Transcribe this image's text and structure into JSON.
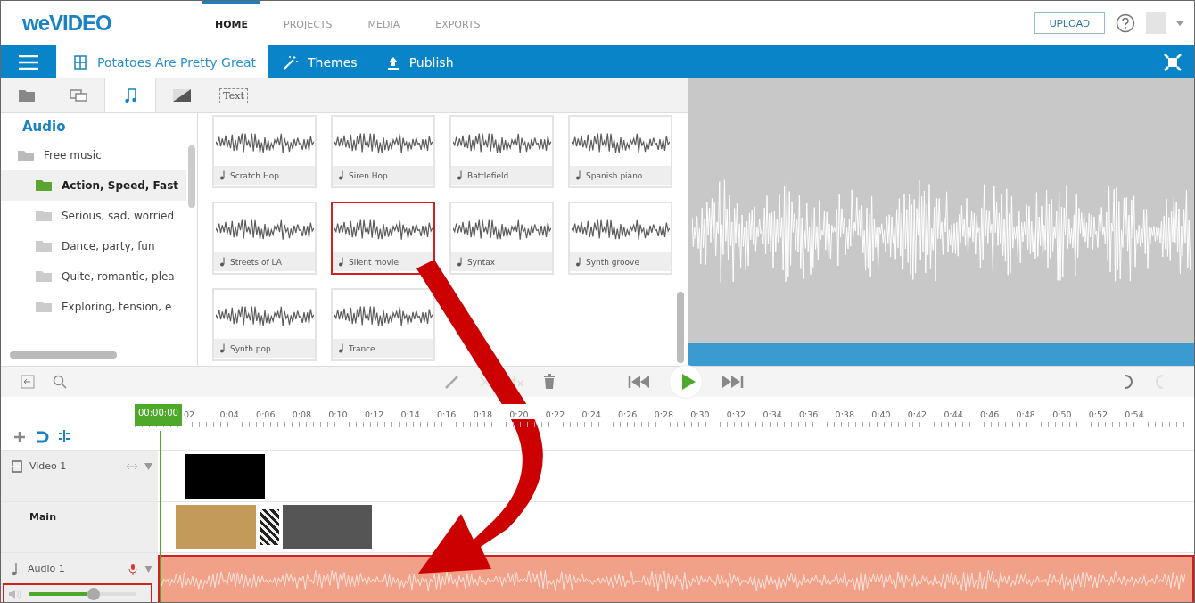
{
  "header": {
    "logo": "weVIDEO",
    "nav": [
      {
        "label": "HOME",
        "selected": true
      },
      {
        "label": "PROJECTS",
        "selected": false
      },
      {
        "label": "MEDIA",
        "selected": false
      },
      {
        "label": "EXPORTS",
        "selected": false
      }
    ],
    "upload": "UPLOAD"
  },
  "project_bar": {
    "title": "Potatoes Are Pretty Great",
    "themes": "Themes",
    "publish": "Publish"
  },
  "media_tabs": [
    {
      "kind": "folder",
      "selected": false
    },
    {
      "kind": "clips",
      "selected": false
    },
    {
      "kind": "music",
      "selected": true
    },
    {
      "kind": "transition",
      "selected": false
    },
    {
      "kind": "text",
      "label": "Text",
      "selected": false
    }
  ],
  "library": {
    "heading": "Audio",
    "tree": [
      {
        "label": "Free music",
        "expanded": true,
        "children": [
          {
            "label": "Action, Speed, Fast",
            "selected": true
          },
          {
            "label": "Serious, sad, worried",
            "selected": false
          },
          {
            "label": "Dance, party, fun",
            "selected": false
          },
          {
            "label": "Quite, romantic, plea",
            "selected": false
          },
          {
            "label": "Exploring, tension, e",
            "selected": false
          }
        ]
      }
    ],
    "items": [
      {
        "title": "Scratch Hop",
        "highlighted": false
      },
      {
        "title": "Siren Hop",
        "highlighted": false
      },
      {
        "title": "Battlefield",
        "highlighted": false
      },
      {
        "title": "Spanish piano",
        "highlighted": false
      },
      {
        "title": "Streets of LA",
        "highlighted": false
      },
      {
        "title": "Silent movie",
        "highlighted": true
      },
      {
        "title": "Syntax",
        "highlighted": false
      },
      {
        "title": "Synth groove",
        "highlighted": false
      },
      {
        "title": "Synth pop",
        "highlighted": false
      },
      {
        "title": "Trance",
        "highlighted": false
      }
    ]
  },
  "timeline": {
    "playhead": "00:00:00",
    "ticks": [
      "02",
      "0:04",
      "0:06",
      "0:08",
      "0:10",
      "0:12",
      "0:14",
      "0:16",
      "0:18",
      "0:20",
      "0:22",
      "0:24",
      "0:26",
      "0:28",
      "0:30",
      "0:32",
      "0:34",
      "0:36",
      "0:38",
      "0:40",
      "0:42",
      "0:44",
      "0:46",
      "0:48",
      "0:50",
      "0:52",
      "0:54"
    ],
    "tracks": [
      {
        "name": "Video 1",
        "kind": "video",
        "main": false
      },
      {
        "name": "Main",
        "kind": "video",
        "main": true
      },
      {
        "name": "Audio 1",
        "kind": "audio",
        "main": false,
        "level": 0.6,
        "highlighted": true
      }
    ]
  }
}
